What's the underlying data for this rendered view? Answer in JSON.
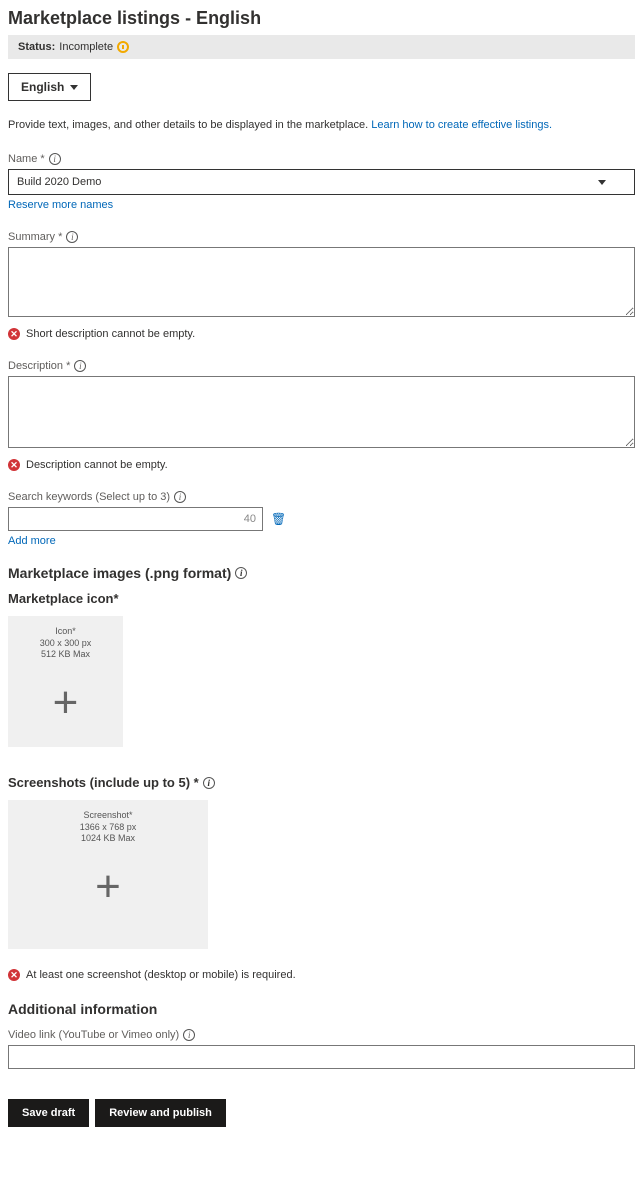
{
  "header": {
    "title": "Marketplace listings - English",
    "status_label": "Status:",
    "status_value": "Incomplete"
  },
  "language_selector": {
    "selected": "English"
  },
  "intro": {
    "text": "Provide text, images, and other details to be displayed in the marketplace. ",
    "link": "Learn how to create effective listings."
  },
  "name_field": {
    "label": "Name *",
    "value": "Build 2020 Demo",
    "reserve_link": "Reserve more names"
  },
  "summary_field": {
    "label": "Summary *",
    "value": "",
    "error": "Short description cannot be empty."
  },
  "description_field": {
    "label": "Description *",
    "value": "",
    "error": "Description cannot be empty."
  },
  "keywords_field": {
    "label": "Search keywords (Select up to 3)",
    "counter": "40",
    "add_more": "Add more"
  },
  "images_section": {
    "heading": "Marketplace images (.png format)",
    "icon_heading": "Marketplace icon*",
    "icon_tile": {
      "title": "Icon*",
      "dims": "300 x 300 px",
      "max": "512 KB Max"
    },
    "screenshots_heading": "Screenshots (include up to 5) *",
    "screenshot_tile": {
      "title": "Screenshot*",
      "dims": "1366 x 768 px",
      "max": "1024 KB Max"
    },
    "screenshot_error": "At least one screenshot (desktop or mobile) is required."
  },
  "additional_section": {
    "heading": "Additional information",
    "video_label": "Video link (YouTube or Vimeo only)",
    "video_value": ""
  },
  "footer": {
    "save": "Save draft",
    "publish": "Review and publish"
  }
}
